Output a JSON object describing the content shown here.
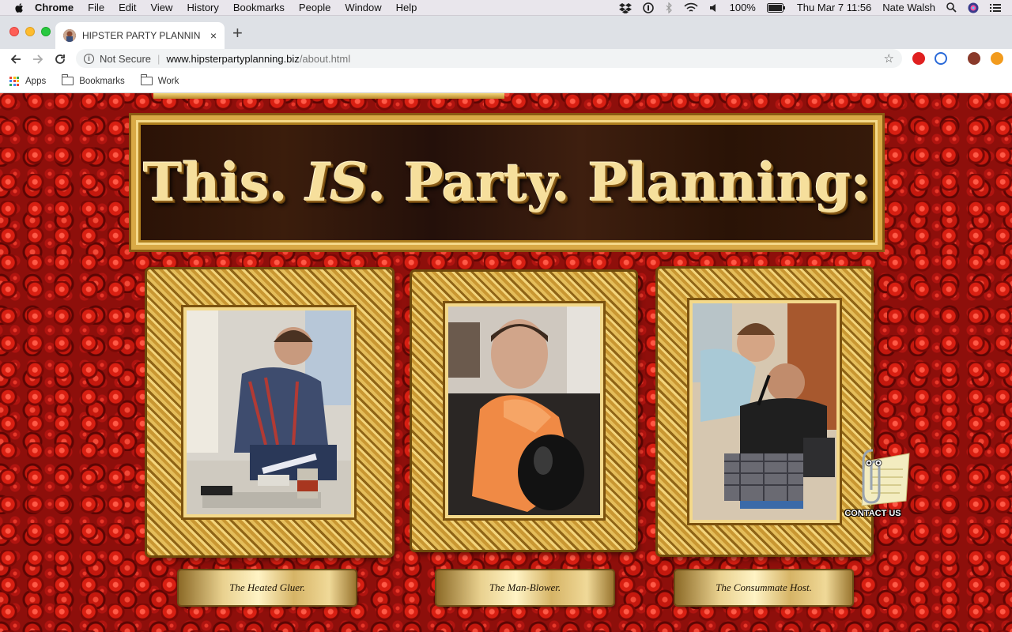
{
  "menubar": {
    "app": "Chrome",
    "items": [
      "File",
      "Edit",
      "View",
      "History",
      "Bookmarks",
      "People",
      "Window",
      "Help"
    ],
    "battery": "100%",
    "datetime": "Thu Mar 7  11:56",
    "user": "Nate Walsh"
  },
  "tab": {
    "title": "HIPSTER PARTY PLANNING DO",
    "close": "×",
    "new_tab": "+"
  },
  "toolbar": {
    "security_label": "Not Secure",
    "url_host": "www.hipsterpartyplanning.biz",
    "url_path": "/about.html"
  },
  "bookmarks": {
    "items": [
      "Apps",
      "Bookmarks",
      "Work"
    ]
  },
  "page": {
    "banner_part1": "This. ",
    "banner_part2": "IS",
    "banner_part3": ". Party. Planning:",
    "captions": [
      "The Heated Gluer.",
      "The Man-Blower.",
      "The Consummate Host."
    ],
    "contact_label": "CONTACT US"
  },
  "colors": {
    "rose_background": "#8e0f0b",
    "gold": "#d9a946",
    "banner_wood": "#2a1206"
  }
}
